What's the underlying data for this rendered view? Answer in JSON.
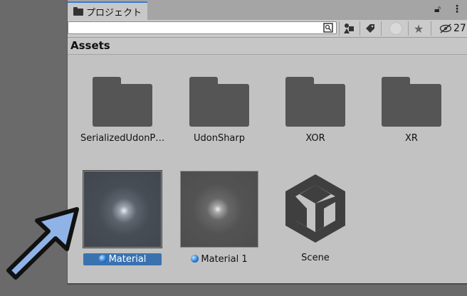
{
  "tab": {
    "title": "プロジェクト"
  },
  "toolbar": {
    "search_value": "",
    "hidden_count": "27"
  },
  "breadcrumb": "Assets",
  "items": [
    {
      "label": "SerializedUdonP…",
      "kind": "folder"
    },
    {
      "label": "UdonSharp",
      "kind": "folder"
    },
    {
      "label": "XOR",
      "kind": "folder"
    },
    {
      "label": "XR",
      "kind": "folder"
    },
    {
      "label": "Material",
      "kind": "material",
      "selected": true
    },
    {
      "label": "Material 1",
      "kind": "material",
      "selected": false
    },
    {
      "label": "Scene",
      "kind": "scene"
    }
  ],
  "colors": {
    "selection": "#3a72b0",
    "arrow_fill": "#8fb3e6",
    "tab_accent": "#3a7bd5"
  }
}
